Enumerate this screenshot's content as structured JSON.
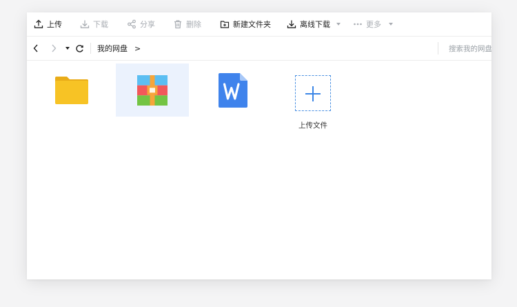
{
  "toolbar": {
    "upload": "上传",
    "download": "下载",
    "share": "分享",
    "delete": "删除",
    "new_folder": "新建文件夹",
    "offline_download": "离线下载",
    "more": "更多"
  },
  "nav": {
    "breadcrumb_root": "我的网盘",
    "breadcrumb_chevron": ">",
    "search_placeholder": "搜索我的网盘"
  },
  "files": [
    {
      "type": "folder",
      "icon": "folder-icon",
      "selected": false
    },
    {
      "type": "archive",
      "icon": "archive-icon",
      "selected": true
    },
    {
      "type": "word",
      "icon": "word-doc-icon",
      "selected": false
    }
  ],
  "upload_tile": {
    "label": "上传文件",
    "icon": "plus-icon"
  },
  "colors": {
    "accent": "#3b86e6",
    "selected_bg": "#ebf2fd",
    "disabled_text": "#a9adb3",
    "folder": "#f7c325",
    "word": "#3f83ec"
  }
}
